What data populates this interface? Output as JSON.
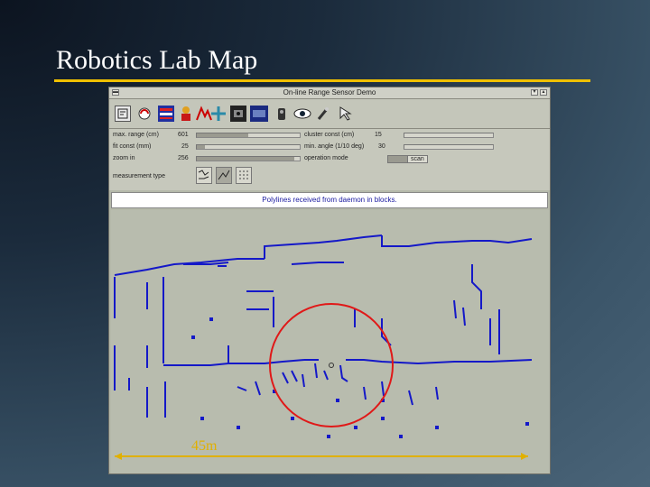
{
  "slide": {
    "title": "Robotics Lab Map",
    "scale_label": "45m"
  },
  "window": {
    "title": "On-line Range Sensor Demo",
    "menu_glyph": "▬",
    "min_glyph": "▾",
    "close_glyph": "▴"
  },
  "toolbar": {
    "icons": [
      "map-icon",
      "refresh-icon",
      "chart-icon",
      "person-icon",
      "line-graph-icon",
      "move-icon",
      "camera-icon",
      "display-icon",
      "robot-icon",
      "eye-icon",
      "wand-icon",
      "pointer-icon"
    ]
  },
  "controls": {
    "left": [
      {
        "label": "max. range (cm)",
        "value": "601",
        "level": 0.5
      },
      {
        "label": "fit const (mm)",
        "value": "25",
        "level": 0.08
      },
      {
        "label": "zoom in",
        "value": "256",
        "level": 0.95
      }
    ],
    "right": [
      {
        "label": "cluster const (cm)",
        "value": "15",
        "level": 0.0
      },
      {
        "label": "min. angle (1/10 deg)",
        "value": "30",
        "level": 0.0
      }
    ],
    "operation_mode_label": "operation mode",
    "operation_mode_value": "scan",
    "operation_mode_btn": "scan",
    "measurement_label": "measurement type"
  },
  "status": {
    "message": "Polylines received from daemon in    blocks."
  },
  "colors": {
    "map_line": "#1418c8",
    "circle": "#e01818",
    "scale": "#e0b000"
  }
}
